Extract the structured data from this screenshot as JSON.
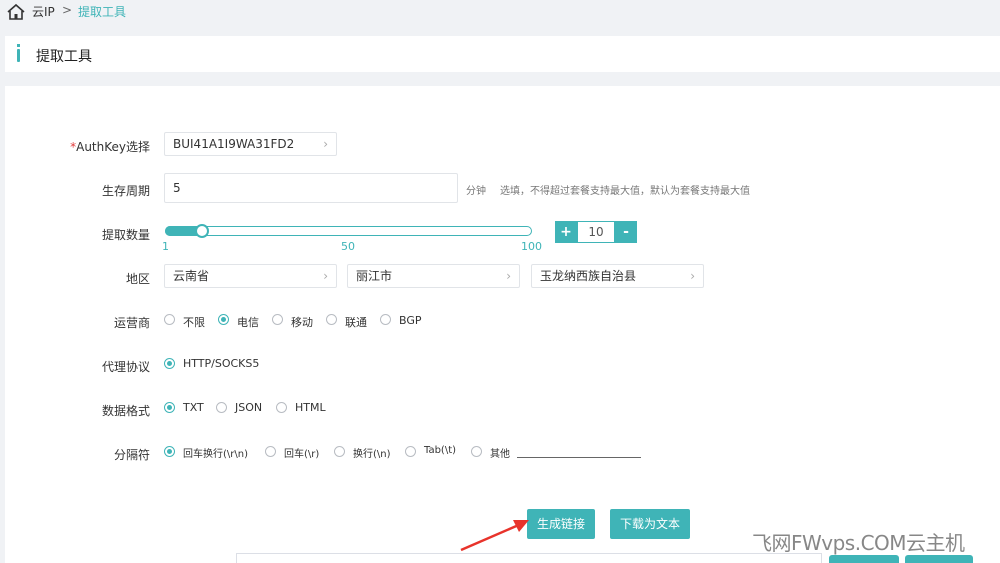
{
  "breadcrumb": {
    "root": "云IP",
    "separator": ">",
    "current": "提取工具",
    "home_icon": "home-icon"
  },
  "page_title": "提取工具",
  "form": {
    "authkey": {
      "required_mark": "*",
      "label": "AuthKey选择",
      "value": "BUI41A1I9WA31FD2"
    },
    "lifetime": {
      "label": "生存周期",
      "value": "5",
      "unit": "分钟",
      "hint": "选填，不得超过套餐支持最大值，默认为套餐支持最大值"
    },
    "quantity": {
      "label": "提取数量",
      "min_label": "1",
      "mid_label": "50",
      "max_label": "100",
      "value": 10,
      "value_text": "10",
      "plus": "+",
      "minus": "-"
    },
    "region": {
      "label": "地区",
      "province": "云南省",
      "city": "丽江市",
      "county": "玉龙纳西族自治县"
    },
    "isp": {
      "label": "运营商",
      "options": [
        "不限",
        "电信",
        "移动",
        "联通",
        "BGP"
      ],
      "selected": "电信"
    },
    "protocol": {
      "label": "代理协议",
      "options": [
        "HTTP/SOCKS5"
      ],
      "selected": "HTTP/SOCKS5"
    },
    "format": {
      "label": "数据格式",
      "options": [
        "TXT",
        "JSON",
        "HTML"
      ],
      "selected": "TXT"
    },
    "separator": {
      "label": "分隔符",
      "options": [
        "回车换行(\\r\\n)",
        "回车(\\r)",
        "换行(\\n)",
        "Tab(\\t)",
        "其他"
      ],
      "selected": "回车换行(\\r\\n)",
      "custom_value": ""
    }
  },
  "actions": {
    "generate": "生成链接",
    "download": "下载为文本"
  },
  "watermark": "飞网FWvps.COM云主机",
  "colors": {
    "accent": "#3fb4b7",
    "required": "#e23c3c",
    "arrow": "#e8332b"
  }
}
